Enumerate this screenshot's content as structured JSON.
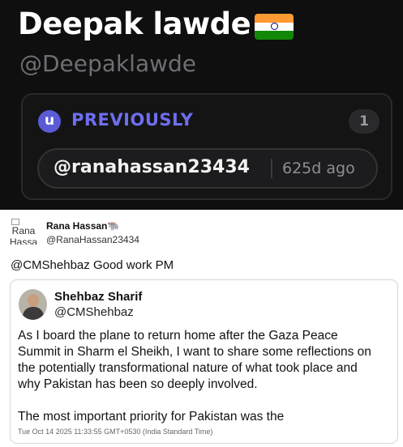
{
  "profile": {
    "display_name": "Deepak lawde",
    "flag_icon": "india-flag-icon",
    "handle": "@Deepaklawde"
  },
  "previously": {
    "badge": "u",
    "label": "PREVIOUSLY",
    "count": "1",
    "handle": "@ranahassan23434",
    "age": "625d ago",
    "colors": {
      "accent": "#6e6ef0",
      "badge_bg": "#5b5bd6",
      "panel_bg": "#0f0f0f"
    }
  },
  "tweet": {
    "avatar_alt": "Rana Hassan",
    "author_name": "Rana Hassan🐃",
    "author_handle": "@RanaHassan23434",
    "text": "@CMShehbaz Good work PM",
    "quote": {
      "author_name": "Shehbaz Sharif",
      "author_handle": "@CMShehbaz",
      "lines": [
        "As I board the plane to return home after the Gaza Peace",
        "Summit in Sharm el Sheikh, I want to share some reflections on",
        "the potentially transformational nature of what took place and",
        "why Pakistan has been so deeply involved."
      ],
      "line2": "The most important priority for Pakistan was the",
      "timestamp": "Tue Oct 14 2025 11:33:55 GMT+0530 (India Standard Time)"
    }
  }
}
